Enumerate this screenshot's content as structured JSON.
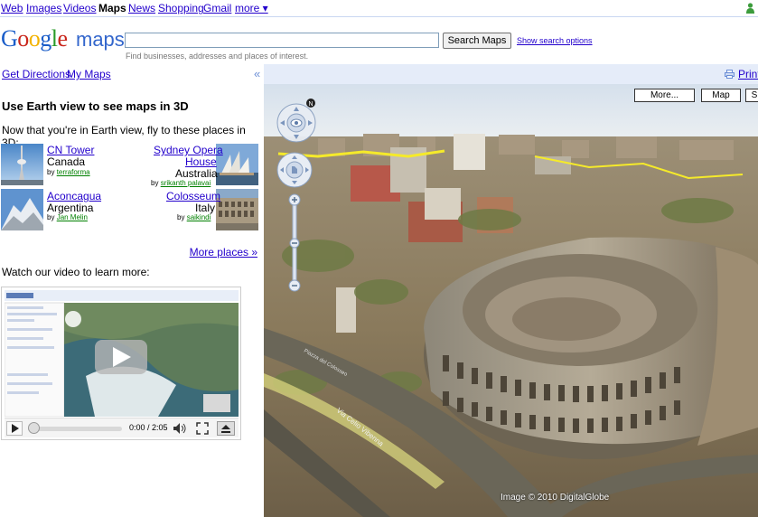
{
  "topnav": {
    "items": [
      "Web",
      "Images",
      "Videos",
      "Maps",
      "News",
      "Shopping",
      "Gmail",
      "more ▾"
    ],
    "current": "Maps"
  },
  "header": {
    "logo_letters": [
      "G",
      "o",
      "o",
      "g",
      "l",
      "e"
    ],
    "logo_colors": [
      "#1a5dc9",
      "#c9261c",
      "#f2b200",
      "#1a5dc9",
      "#2a9b29",
      "#c9261c"
    ],
    "product": "maps",
    "search_value": "",
    "search_button": "Search Maps",
    "show_options": "Show search options",
    "hint": "Find businesses, addresses and places of interest."
  },
  "panelbar": {
    "get_directions": "Get Directions",
    "my_maps": "My Maps",
    "collapse": "«"
  },
  "mapbar": {
    "print": "Print"
  },
  "panel": {
    "title": "Use Earth view to see maps in 3D",
    "subtitle": "Now that you're in Earth view, fly to these places in 3D:",
    "places": [
      {
        "name": "CN Tower",
        "country": "Canada",
        "by_prefix": "by",
        "by": "terraforma"
      },
      {
        "name": "Sydney Opera House",
        "name_line1": "Sydney Opera",
        "name_line2": "House",
        "country": "Australia",
        "by_prefix": "by",
        "by": "srikanth palavai"
      },
      {
        "name": "Aconcagua",
        "country": "Argentina",
        "by_prefix": "by",
        "by": "Jan Melin"
      },
      {
        "name": "Colosseum",
        "country": "Italy",
        "by_prefix": "by",
        "by": "saikindi"
      }
    ],
    "more_places": "More places »",
    "video_label": "Watch our video to learn more:",
    "video_time": "0:00 / 2:05"
  },
  "map": {
    "tabs": [
      "More...",
      "Map",
      "S"
    ],
    "copyright": "Image © 2010 DigitalGlobe",
    "compass_letter": "N",
    "street_label_1": "Via Celio Vibenna",
    "street_label_2": "Piazza del Colosseo",
    "sky_color": "#dfe7f0",
    "accent": "#3366cc"
  }
}
